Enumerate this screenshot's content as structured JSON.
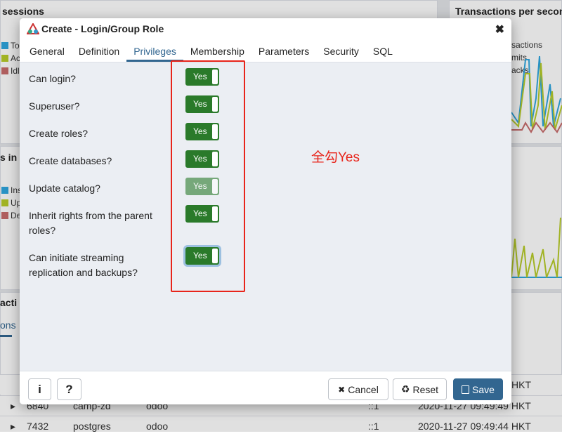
{
  "background": {
    "sessions_title": "sessions",
    "sessions_legend": [
      {
        "label": "To",
        "color": "#2fa7e0"
      },
      {
        "label": "Ac",
        "color": "#b8cc2a"
      },
      {
        "label": "Idl",
        "color": "#c86b6b"
      }
    ],
    "tps_title": "Transactions per secon",
    "tps_legend": [
      "sactions",
      "mits",
      "acks"
    ],
    "tuples_title": "s in",
    "tuples_legend": [
      {
        "label": "Ins",
        "color": "#2fa7e0"
      },
      {
        "label": "Up",
        "color": "#b8cc2a"
      },
      {
        "label": "De",
        "color": "#c86b6b"
      }
    ],
    "activity_title": "acti",
    "activity_tab": "ons",
    "rows": [
      {
        "pid": "",
        "user": "",
        "db": "",
        "client": "",
        "start": "HKT"
      },
      {
        "pid": "6840",
        "user": "camp-zd",
        "db": "odoo",
        "client": "::1",
        "start": "2020-11-27 09:49:49 HKT"
      },
      {
        "pid": "7432",
        "user": "postgres",
        "db": "odoo",
        "client": "::1",
        "start": "2020-11-27 09:49:44 HKT"
      }
    ]
  },
  "dialog": {
    "title": "Create - Login/Group Role",
    "tabs": [
      "General",
      "Definition",
      "Privileges",
      "Membership",
      "Parameters",
      "Security",
      "SQL"
    ],
    "active_tab": "Privileges",
    "fields": [
      {
        "label": "Can login?",
        "value": "Yes",
        "disabled": false
      },
      {
        "label": "Superuser?",
        "value": "Yes",
        "disabled": false
      },
      {
        "label": "Create roles?",
        "value": "Yes",
        "disabled": false
      },
      {
        "label": "Create databases?",
        "value": "Yes",
        "disabled": false
      },
      {
        "label": "Update catalog?",
        "value": "Yes",
        "disabled": true
      },
      {
        "label": "Inherit rights from the parent roles?",
        "value": "Yes",
        "disabled": false
      },
      {
        "label": "Can initiate streaming replication and backups?",
        "value": "Yes",
        "disabled": false
      }
    ],
    "annotation": "全勾Yes",
    "buttons": {
      "info": "i",
      "help": "?",
      "cancel": "Cancel",
      "reset": "Reset",
      "save": "Save"
    }
  },
  "colors": {
    "accent": "#326690",
    "toggle_on": "#2a7a2a",
    "annotation": "#e8241a"
  }
}
